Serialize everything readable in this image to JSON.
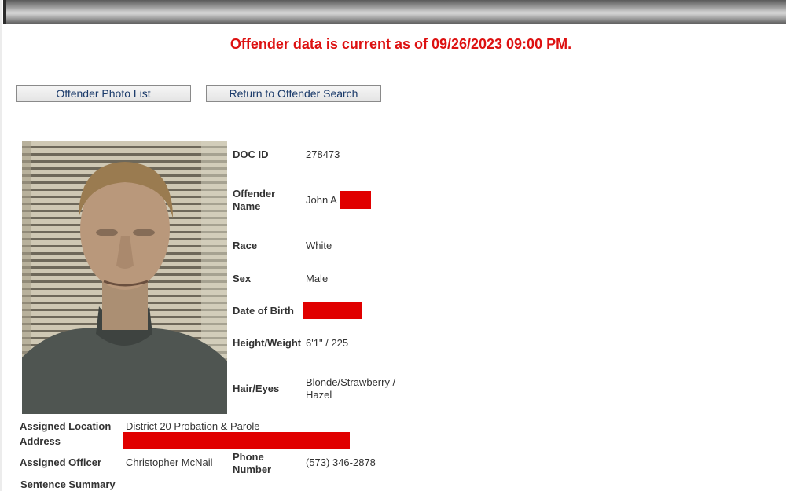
{
  "header": {
    "status_text": "Offender data is current as of 09/26/2023 09:00 PM."
  },
  "buttons": {
    "photo_list": "Offender Photo List",
    "return_search": "Return to Offender Search"
  },
  "photo": {
    "alt": "Offender photo"
  },
  "colors": {
    "status": "#dd1111",
    "redaction": "#e00000",
    "button_text": "#1a3a6a"
  },
  "offender": {
    "doc_id_label": "DOC ID",
    "doc_id": "278473",
    "name_label": "Offender Name",
    "name": "John A",
    "race_label": "Race",
    "race": "White",
    "sex_label": "Sex",
    "sex": "Male",
    "dob_label": "Date of Birth",
    "hw_label": "Height/Weight",
    "hw": "6'1\" / 225",
    "hair_label": "Hair/Eyes",
    "hair": "Blonde/Strawberry / Hazel",
    "location_label": "Assigned Location",
    "location": "District 20 Probation & Parole",
    "address_label": "Address",
    "officer_label": "Assigned Officer",
    "officer": "Christopher McNail",
    "phone_label": "Phone Number",
    "phone": "(573) 346-2878",
    "sentence_label": "Sentence Summary"
  }
}
